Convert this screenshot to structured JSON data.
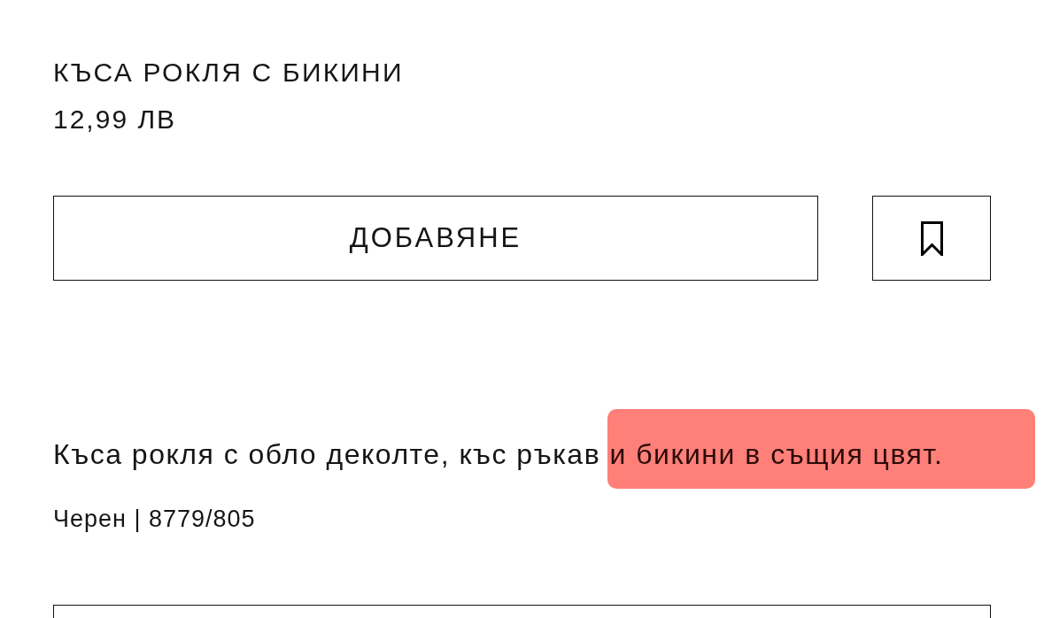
{
  "product": {
    "title": "КЪСА РОКЛЯ С БИКИНИ",
    "price": "12,99 ЛВ"
  },
  "actions": {
    "add_button": "ДОБАВЯНЕ"
  },
  "description": {
    "parts": [
      {
        "text": "Къса рокля с обло деколте, къс ръкав ",
        "highlighted": false
      },
      {
        "text": "и бикини в същия цвят.",
        "highlighted": true
      }
    ]
  },
  "color_reference": "Черен | 8779/805"
}
